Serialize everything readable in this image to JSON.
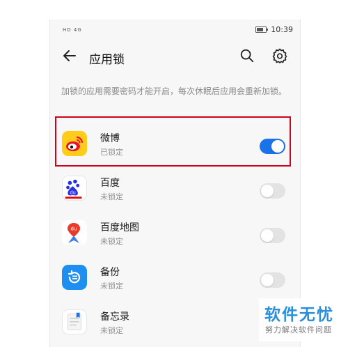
{
  "statusbar": {
    "left_indicators": "HD 4G",
    "time": "10:39"
  },
  "appbar": {
    "title": "应用锁",
    "icons": [
      "back-arrow-icon",
      "search-icon",
      "gear-icon"
    ]
  },
  "description": "加锁的应用需要密码才能开启，每次休眠后应用会重新加锁。",
  "apps": [
    {
      "name": "微博",
      "status": "已锁定",
      "locked": true,
      "icon": "weibo-icon"
    },
    {
      "name": "百度",
      "status": "未锁定",
      "locked": false,
      "icon": "baidu-icon"
    },
    {
      "name": "百度地图",
      "status": "未锁定",
      "locked": false,
      "icon": "baidu-map-icon"
    },
    {
      "name": "备份",
      "status": "未锁定",
      "locked": false,
      "icon": "backup-icon"
    },
    {
      "name": "备忘录",
      "status": "未锁定",
      "locked": false,
      "icon": "memo-icon"
    }
  ],
  "watermark": {
    "title": "软件无忧",
    "subtitle": "努力解决软件问题"
  },
  "colors": {
    "toggle_on": "#1a73e8",
    "highlight_border": "#d0021b",
    "watermark": "#2d8fd9"
  }
}
